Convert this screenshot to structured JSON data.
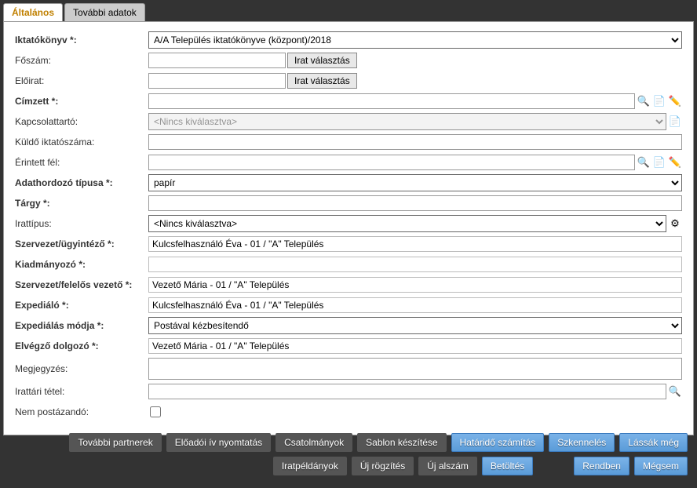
{
  "tabs": {
    "general": "Általános",
    "additional": "További adatok"
  },
  "labels": {
    "iktatokonyv": "Iktatókönyv *:",
    "foszam": "Főszám:",
    "eloirat": "Előirat:",
    "cimzett": "Címzett *:",
    "kapcsolattarto": "Kapcsolattartó:",
    "kuldo_iktatoszama": "Küldő iktatószáma:",
    "erintett_fel": "Érintett fél:",
    "adathordozo_tipusa": "Adathordozó típusa *:",
    "targy": "Tárgy *:",
    "irattipus": "Irattípus:",
    "szervezet_ugyintezo": "Szervezet/ügyintéző *:",
    "kiadmanyozo": "Kiadmányozó *:",
    "szervezet_felelos": "Szervezet/felelős vezető *:",
    "expedialo": "Expediáló *:",
    "expedialas_modja": "Expediálás módja *:",
    "elvegzo_dolgozo": "Elvégző dolgozó *:",
    "megjegyzes": "Megjegyzés:",
    "irattari_tetel": "Irattári tétel:",
    "nem_postazando": "Nem postázandó:"
  },
  "values": {
    "iktatokonyv": "A/A Település iktatókönyve (központ)/2018",
    "foszam": "",
    "eloirat": "",
    "cimzett": "",
    "kapcsolattarto": "<Nincs kiválasztva>",
    "kuldo_iktatoszama": "",
    "erintett_fel": "",
    "adathordozo_tipusa": "papír",
    "targy": "",
    "irattipus": "<Nincs kiválasztva>",
    "szervezet_ugyintezo": "Kulcsfelhasználó Éva - 01 / \"A\" Település",
    "kiadmanyozo": "",
    "szervezet_felelos": "Vezető Mária - 01 / \"A\" Település",
    "expedialo": "Kulcsfelhasználó Éva - 01 / \"A\" Település",
    "expedialas_modja": "Postával kézbesítendő",
    "elvegzo_dolgozo": "Vezető Mária - 01 / \"A\" Település",
    "megjegyzes": "",
    "irattari_tetel": "",
    "nem_postazando": false
  },
  "buttons": {
    "irat_valasztas": "Irat választás",
    "tovabbi_partnerek": "További partnerek",
    "eloadoi_iv": "Előadói ív nyomtatás",
    "csatolmanyok": "Csatolmányok",
    "sablon_keszitese": "Sablon készítése",
    "hatarido_szamitas": "Határidő számítás",
    "szkenneles": "Szkennelés",
    "lassak_meg": "Lássák még",
    "iratpeldanyok": "Iratpéldányok",
    "uj_rogzites": "Új rögzítés",
    "uj_alszam": "Új alszám",
    "betoltes": "Betöltés",
    "rendben": "Rendben",
    "megsem": "Mégsem"
  }
}
